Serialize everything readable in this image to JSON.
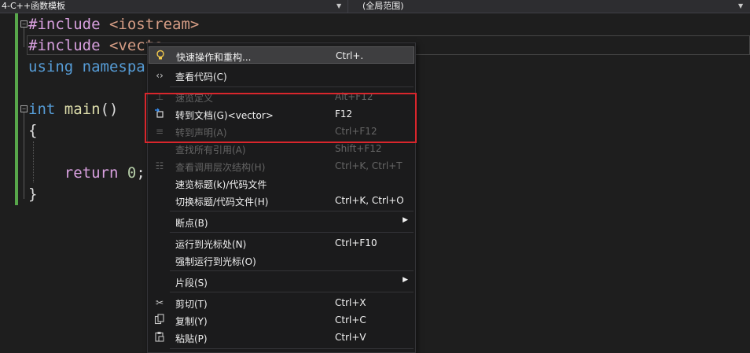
{
  "navbar": {
    "project": "4-C++函数模板",
    "scope": "(全局范围)"
  },
  "code": {
    "line1": {
      "directive": "#include",
      "header": "<iostream>"
    },
    "line2": {
      "directive": "#include",
      "header": "<vecto"
    },
    "line3": {
      "keyword": "using",
      "rest": "namespa"
    },
    "line5": {
      "type": "int",
      "name": "main",
      "parens": "()"
    },
    "line6": {
      "brace": "{"
    },
    "line8": {
      "keyword": "return",
      "value": "0",
      "end": ";"
    },
    "line9": {
      "brace": "}"
    }
  },
  "menu": {
    "quick_actions": {
      "label": "快速操作和重构...",
      "shortcut": "Ctrl+."
    },
    "view_code": {
      "label": "查看代码(C)"
    },
    "peek_definition": {
      "label": "速览定义",
      "shortcut": "Alt+F12"
    },
    "go_to_document": {
      "label": "转到文档(G)<vector>",
      "shortcut": "F12"
    },
    "go_to_declaration": {
      "label": "转到声明(A)",
      "shortcut": "Ctrl+F12"
    },
    "find_all_references": {
      "label": "查找所有引用(A)",
      "shortcut": "Shift+F12"
    },
    "view_call_hierarchy": {
      "label": "查看调用层次结构(H)",
      "shortcut": "Ctrl+K, Ctrl+T"
    },
    "peek_header": {
      "label": "速览标题(k)/代码文件"
    },
    "toggle_header": {
      "label": "切换标题/代码文件(H)",
      "shortcut": "Ctrl+K, Ctrl+O"
    },
    "breakpoint": {
      "label": "断点(B)"
    },
    "run_to_cursor": {
      "label": "运行到光标处(N)",
      "shortcut": "Ctrl+F10"
    },
    "force_run_to_cursor": {
      "label": "强制运行到光标(O)"
    },
    "snippet": {
      "label": "片段(S)"
    },
    "cut": {
      "label": "剪切(T)",
      "shortcut": "Ctrl+X"
    },
    "copy": {
      "label": "复制(Y)",
      "shortcut": "Ctrl+C"
    },
    "paste": {
      "label": "粘贴(P)",
      "shortcut": "Ctrl+V"
    }
  },
  "colors": {
    "highlight_box": "#d9262c",
    "change_indicator": "#57a64a",
    "keyword": "#569cd6",
    "string": "#d69d85"
  }
}
